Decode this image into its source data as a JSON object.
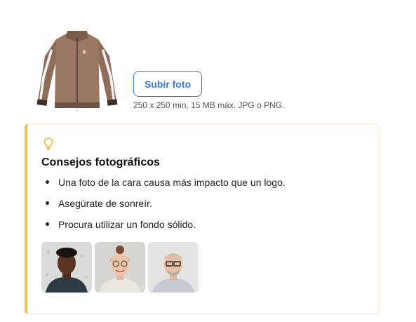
{
  "upload": {
    "button_label": "Subir foto",
    "hint": "250 x 250 min, 15 MB máx. JPG o PNG.",
    "thumbnail_icon": "jacket-image"
  },
  "tips": {
    "icon": "lightbulb-icon",
    "accent_color": "#f4c04e",
    "title": "Consejos fotográficos",
    "items": [
      "Una foto de la cara causa más impacto que un logo.",
      "Asegúrate de sonreír.",
      "Procura utilizar un fondo sólido."
    ],
    "example_photos": [
      "portrait-young-man",
      "portrait-woman-glasses",
      "portrait-man-glasses"
    ]
  },
  "colors": {
    "primary": "#3b78e7"
  }
}
